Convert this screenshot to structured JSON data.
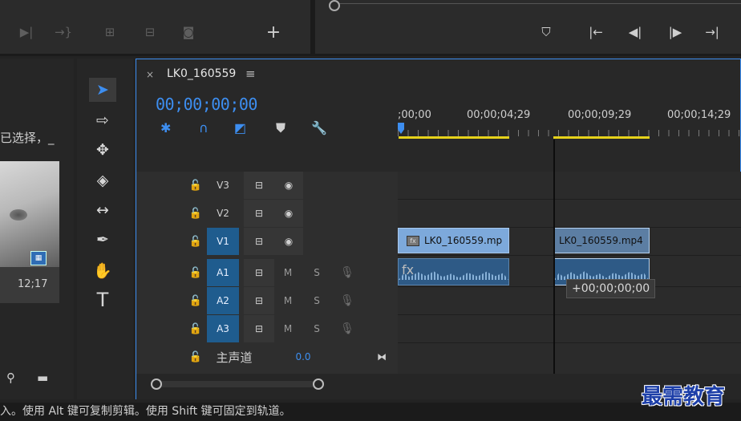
{
  "source_monitor": {
    "controls": [
      "mark-in",
      "mark-out",
      "insert",
      "overwrite",
      "export-frame"
    ],
    "add_button_label": "+"
  },
  "program_monitor": {
    "controls": [
      "add-marker",
      "go-to-in",
      "step-back",
      "step-forward",
      "go-to-out"
    ]
  },
  "project_panel": {
    "selection_text": "已选择，_",
    "thumbnail_duration": "12;17"
  },
  "timeline": {
    "sequence_name": "LK0_160559",
    "menu_glyph": "≡",
    "close_glyph": "×",
    "timecode": "00;00;00;00",
    "ruler_labels": [
      ";00;00",
      "00;00;04;29",
      "00;00;09;29",
      "00;00;14;29"
    ],
    "video_tracks": [
      {
        "name": "V3",
        "targeted": false
      },
      {
        "name": "V2",
        "targeted": false
      },
      {
        "name": "V1",
        "targeted": true
      }
    ],
    "audio_tracks": [
      {
        "name": "A1",
        "m": "M",
        "s": "S"
      },
      {
        "name": "A2",
        "m": "M",
        "s": "S"
      },
      {
        "name": "A3",
        "m": "M",
        "s": "S"
      }
    ],
    "master": {
      "label": "主声道",
      "value": "0.0"
    },
    "clips": {
      "v1_clip": "LK0_160559.mp",
      "v1_ghost_clip": "LK0_160559.mp4"
    },
    "drag_tooltip": "+00;00;00;00",
    "fx_badge": "fx"
  },
  "status_bar": {
    "text": "入。使用 Alt 键可复制剪辑。使用 Shift 键可固定到轨道。"
  },
  "watermark": "最需教育",
  "colors": {
    "accent": "#3d8ef0",
    "in_out_bar": "#e6d21a",
    "clip": "#7da9db",
    "track_target": "#1f5c8e"
  }
}
